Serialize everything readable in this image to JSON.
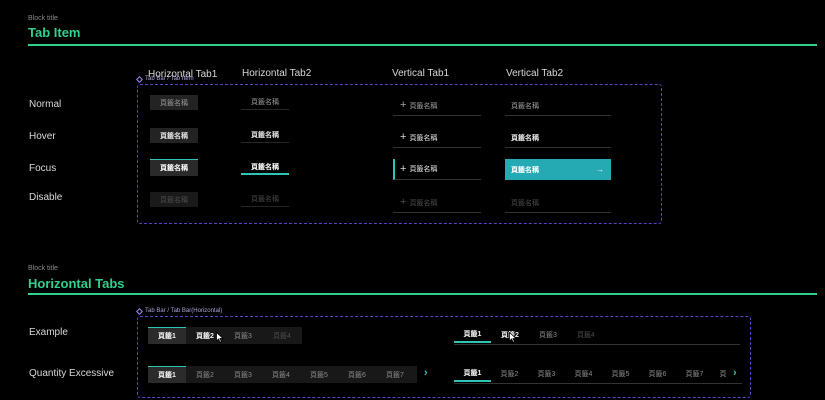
{
  "section1": {
    "caption": "Block title",
    "title": "Tab Item",
    "component_label": "Tab Bar / Tab Item",
    "columns": [
      "Horizontal Tab1",
      "Horizontal Tab2",
      "Vertical Tab1",
      "Vertical Tab2"
    ],
    "rows": [
      "Normal",
      "Hover",
      "Focus",
      "Disable"
    ],
    "tab_text": "頁籤名稱",
    "plus_glyph": "+",
    "arrow_glyph": "→"
  },
  "section2": {
    "caption": "Block title",
    "title": "Horizontal Tabs",
    "component_label": "Tab Bar / Tab Bar(Horizontal)",
    "rows": [
      "Example",
      "Quantity Excessive"
    ],
    "example_tabs": [
      "頁籤1",
      "頁籤2",
      "頁籤3",
      "頁籤4"
    ],
    "excessive_tabs": [
      "頁籤1",
      "頁籤2",
      "頁籤3",
      "頁籤4",
      "頁籤5",
      "頁籤6",
      "頁籤7",
      "頁"
    ],
    "chevron": "›"
  },
  "colors": {
    "accent_green": "#2fd08c",
    "accent_teal": "#25a9b3",
    "component_outline": "#5b45c4",
    "background": "#000000"
  }
}
